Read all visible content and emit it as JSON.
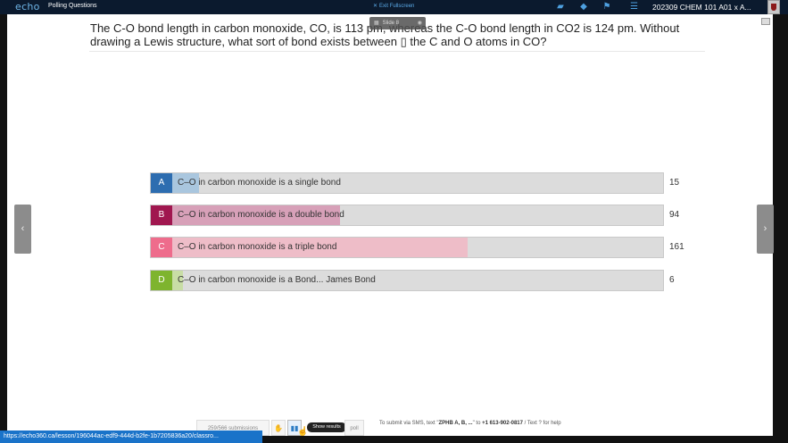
{
  "topbar": {
    "logo": "echo",
    "section": "Polling Questions",
    "exit_fullscreen": "Exit Fullscreen",
    "course_title": "202309 CHEM 101 A01 x A..."
  },
  "slide_badge": {
    "label": "Slide 8"
  },
  "question": {
    "text": "The C-O bond length in carbon monoxide, CO, is 113 pm, whereas the C-O bond length in CO2 is 124 pm. Without drawing a Lewis structure, what sort of bond exists between ▯ the C and O atoms in CO?"
  },
  "answers": [
    {
      "letter": "A",
      "text": "C–O in carbon monoxide is a single bond",
      "count": "15",
      "fraction": 0.054,
      "letter_color": "#2d6db0",
      "fill_color": "#a9c6de"
    },
    {
      "letter": "B",
      "text": "C–O in carbon monoxide is a double bond",
      "count": "94",
      "fraction": 0.34,
      "letter_color": "#a0174f",
      "fill_color": "#d7a0b8"
    },
    {
      "letter": "C",
      "text": "C–O in carbon monoxide is a triple bond",
      "count": "161",
      "fraction": 0.6,
      "letter_color": "#ee6c8c",
      "fill_color": "#eebdc8"
    },
    {
      "letter": "D",
      "text": "C–O in carbon monoxide is a Bond... James Bond",
      "count": "6",
      "fraction": 0.022,
      "letter_color": "#7eb42e",
      "fill_color": "#c8dda5"
    }
  ],
  "nav": {
    "prev": "‹",
    "next": "›"
  },
  "bottom": {
    "submissions": "259/566 submissions",
    "tooltip": "Show results",
    "poll_label": "poll",
    "sms_prefix": "To submit via SMS, text \"",
    "sms_code": "ZPHB A, B, ...",
    "sms_mid": "\" to ",
    "sms_number": "+1 613-902-0817",
    "sms_suffix": " / Text ? for help"
  },
  "status_url": "https://echo360.ca/lesson/196044ac-edf9-444d-b2fe-1b7205836a20/classro..."
}
